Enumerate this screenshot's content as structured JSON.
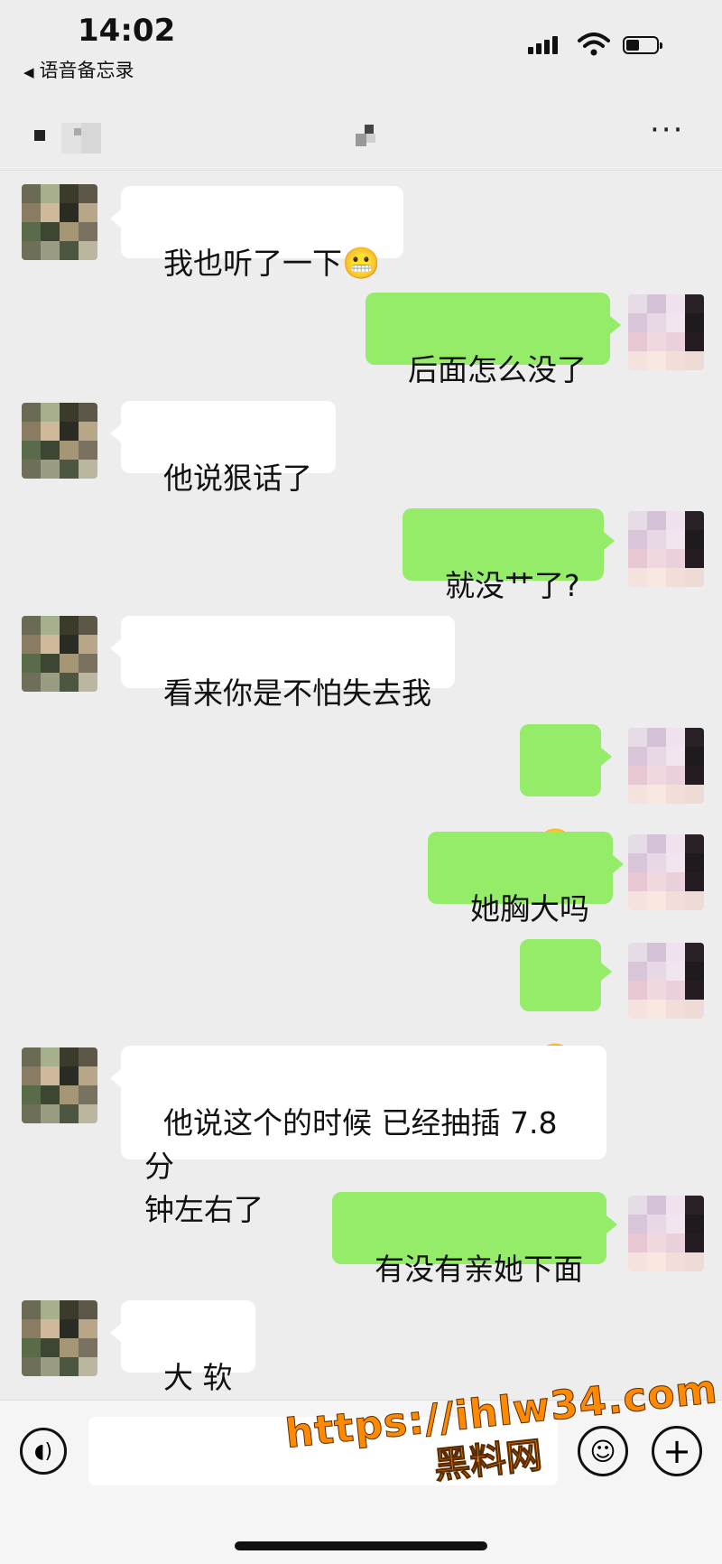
{
  "status_bar": {
    "time": "14:02",
    "back_app": "语音备忘录"
  },
  "nav": {
    "more_label": "···"
  },
  "messages": [
    {
      "side": "left",
      "text": "我也听了一下",
      "emoji": "😬"
    },
    {
      "side": "right",
      "text": "后面怎么没了"
    },
    {
      "side": "left",
      "text": "他说狠话了"
    },
    {
      "side": "right",
      "text": "就没艹了?"
    },
    {
      "side": "left",
      "text": "看来你是不怕失去我"
    },
    {
      "side": "right",
      "text": "",
      "emoji": "🤤"
    },
    {
      "side": "right",
      "text": "她胸大吗"
    },
    {
      "side": "right",
      "text": "",
      "emoji": "🥺"
    },
    {
      "side": "left",
      "text": "他说这个的时候 已经抽插 7.8 分\n钟左右了"
    },
    {
      "side": "right",
      "text": "有没有亲她下面"
    },
    {
      "side": "left",
      "text": "大 软"
    }
  ],
  "input_bar": {
    "voice_icon": "voice-icon",
    "emoji_icon": "emoji-icon",
    "plus_icon": "plus-icon"
  },
  "watermark": {
    "url": "https://ihlw34.com",
    "name": "黑料网"
  },
  "colors": {
    "background": "#ededed",
    "bubble_right": "#95ec69",
    "bubble_left": "#ffffff",
    "watermark": "#ff8a00"
  }
}
